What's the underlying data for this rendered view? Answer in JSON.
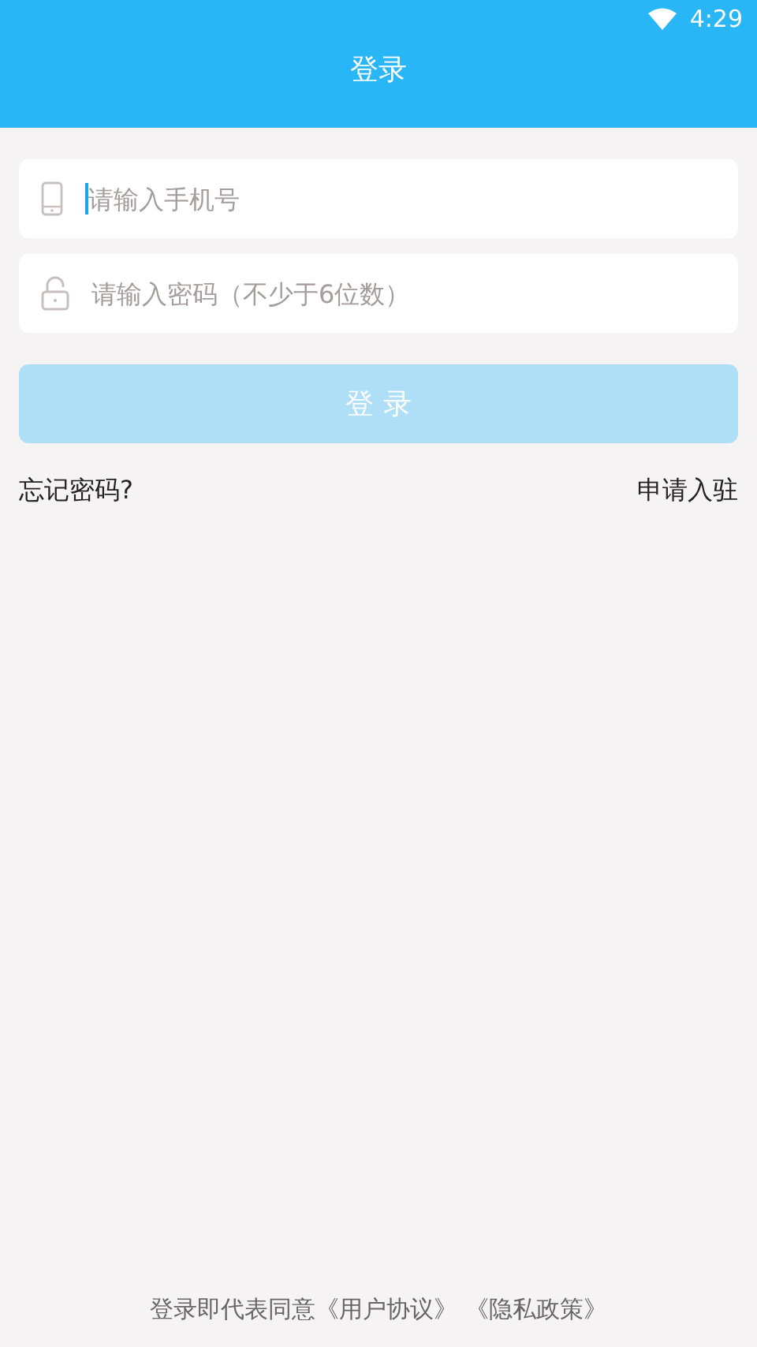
{
  "status_bar": {
    "time": "4:29"
  },
  "header": {
    "title": "登录"
  },
  "fields": [
    {
      "kind": "phone",
      "placeholder": "请输入手机号",
      "focused": true
    },
    {
      "kind": "password",
      "placeholder": "请输入密码（不少于6位数）",
      "focused": false
    }
  ],
  "login_button": {
    "label": "登 录",
    "disabled": true
  },
  "links": {
    "left": "忘记密码?",
    "right": "申请入驻"
  },
  "footer": {
    "text": "登录即代表同意",
    "links": [
      "《用户协议》",
      "《隐私政策》"
    ]
  }
}
